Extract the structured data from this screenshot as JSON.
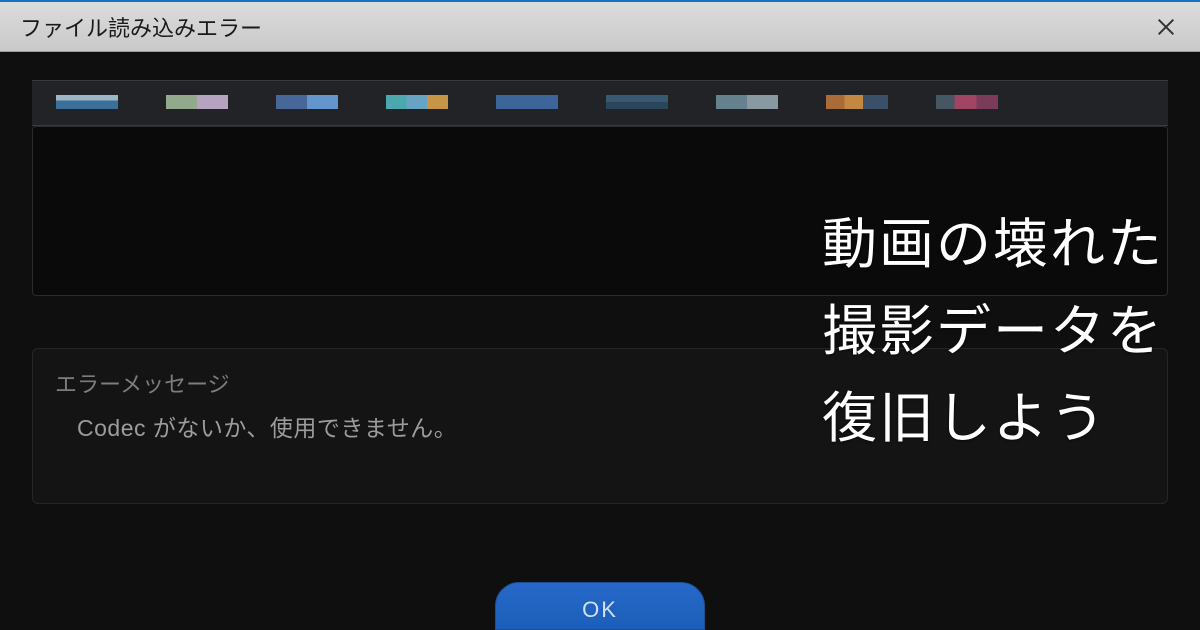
{
  "titlebar": {
    "title": "ファイル読み込みエラー"
  },
  "thumbnails": [
    {
      "bg": "linear-gradient(#a9c6d8 40%, #3d7aa8 40%)"
    },
    {
      "bg": "linear-gradient(90deg,#9fb89a 50%,#c7b1d1 50%)"
    },
    {
      "bg": "linear-gradient(90deg,#4a6fa5 50%,#6aa2e0 50%)"
    },
    {
      "bg": "linear-gradient(90deg,#4fb7bd 33%,#6fb1d6 33% 66%,#d9a24a 66%)"
    },
    {
      "bg": "#3f6da6"
    },
    {
      "bg": "linear-gradient(#3a5f7a 50%,#2a4a60 50%)"
    },
    {
      "bg": "linear-gradient(90deg,#6c8c9a 50%,#93a6b0 50%)"
    },
    {
      "bg": "linear-gradient(90deg,#b8743a 30%,#d69444 30% 60%,#3e5470 60%)"
    },
    {
      "bg": "linear-gradient(90deg,#4a5b6a 30%,#b0476a 30% 65%,#843f5f 65%)"
    }
  ],
  "error": {
    "label": "エラーメッセージ",
    "message": "Codec がないか、使用できません。"
  },
  "buttons": {
    "ok": "OK"
  },
  "overlay": {
    "text": "動画の壊れた\n撮影データを\n復旧しよう"
  }
}
